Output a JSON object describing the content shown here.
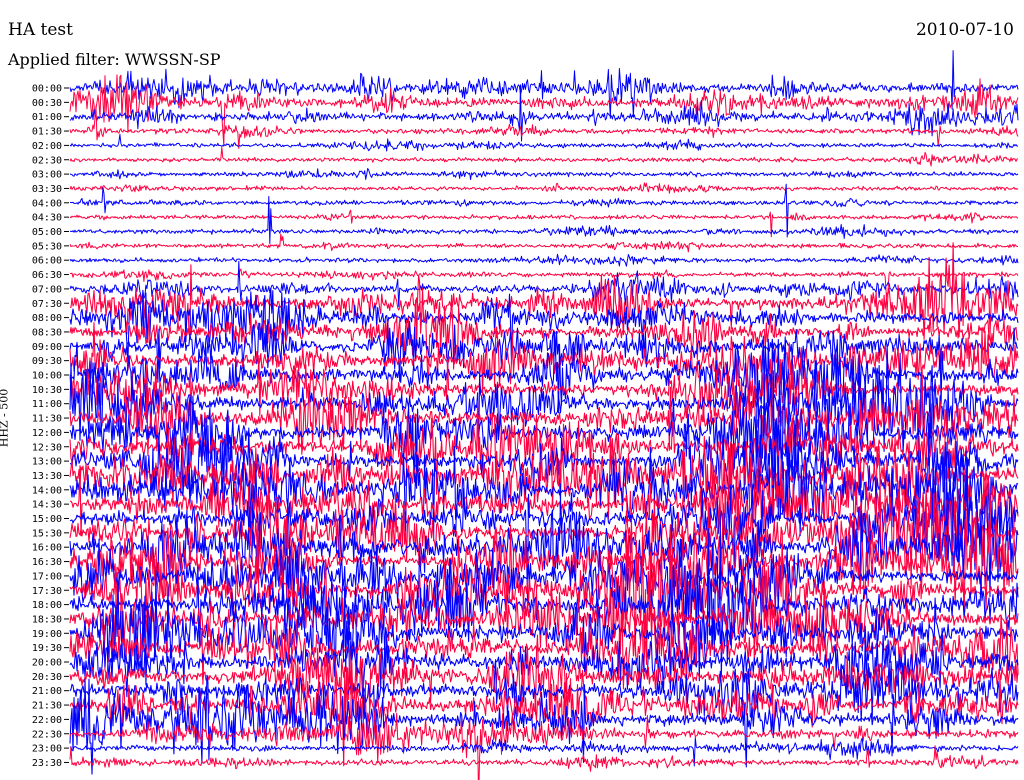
{
  "header": {
    "title": "HA test",
    "date": "2010-07-10",
    "filter": "Applied filter: WWSSN-SP"
  },
  "chart_data": {
    "type": "line",
    "title": "HA test",
    "subtitle": "Applied filter: WWSSN-SP",
    "date": "2010-07-10",
    "ylabel": "HHZ - 500",
    "xlabel": "",
    "grid": false,
    "colors": [
      "#0000ff",
      "#ff0040"
    ],
    "row_minutes": 30,
    "categories": [
      "00:00",
      "00:30",
      "01:00",
      "01:30",
      "02:00",
      "02:30",
      "03:00",
      "03:30",
      "04:00",
      "04:30",
      "05:00",
      "05:30",
      "06:00",
      "06:30",
      "07:00",
      "07:30",
      "08:00",
      "08:30",
      "09:00",
      "09:30",
      "10:00",
      "10:30",
      "11:00",
      "11:30",
      "12:00",
      "12:30",
      "13:00",
      "13:30",
      "14:00",
      "14:30",
      "15:00",
      "15:30",
      "16:00",
      "16:30",
      "17:00",
      "17:30",
      "18:00",
      "18:30",
      "19:00",
      "19:30",
      "20:00",
      "20:30",
      "21:00",
      "21:30",
      "22:00",
      "22:30",
      "23:00",
      "23:30"
    ],
    "relative_activity": [
      0.55,
      0.6,
      0.5,
      0.22,
      0.16,
      0.14,
      0.16,
      0.14,
      0.16,
      0.14,
      0.18,
      0.16,
      0.16,
      0.2,
      0.45,
      0.85,
      0.8,
      0.7,
      0.8,
      0.85,
      0.85,
      0.85,
      0.9,
      0.95,
      1.0,
      1.0,
      1.0,
      1.0,
      1.0,
      1.0,
      1.0,
      1.0,
      1.0,
      1.0,
      1.0,
      1.0,
      1.0,
      1.0,
      1.0,
      1.0,
      0.95,
      0.9,
      0.9,
      0.85,
      0.8,
      0.55,
      0.3,
      0.3
    ]
  }
}
